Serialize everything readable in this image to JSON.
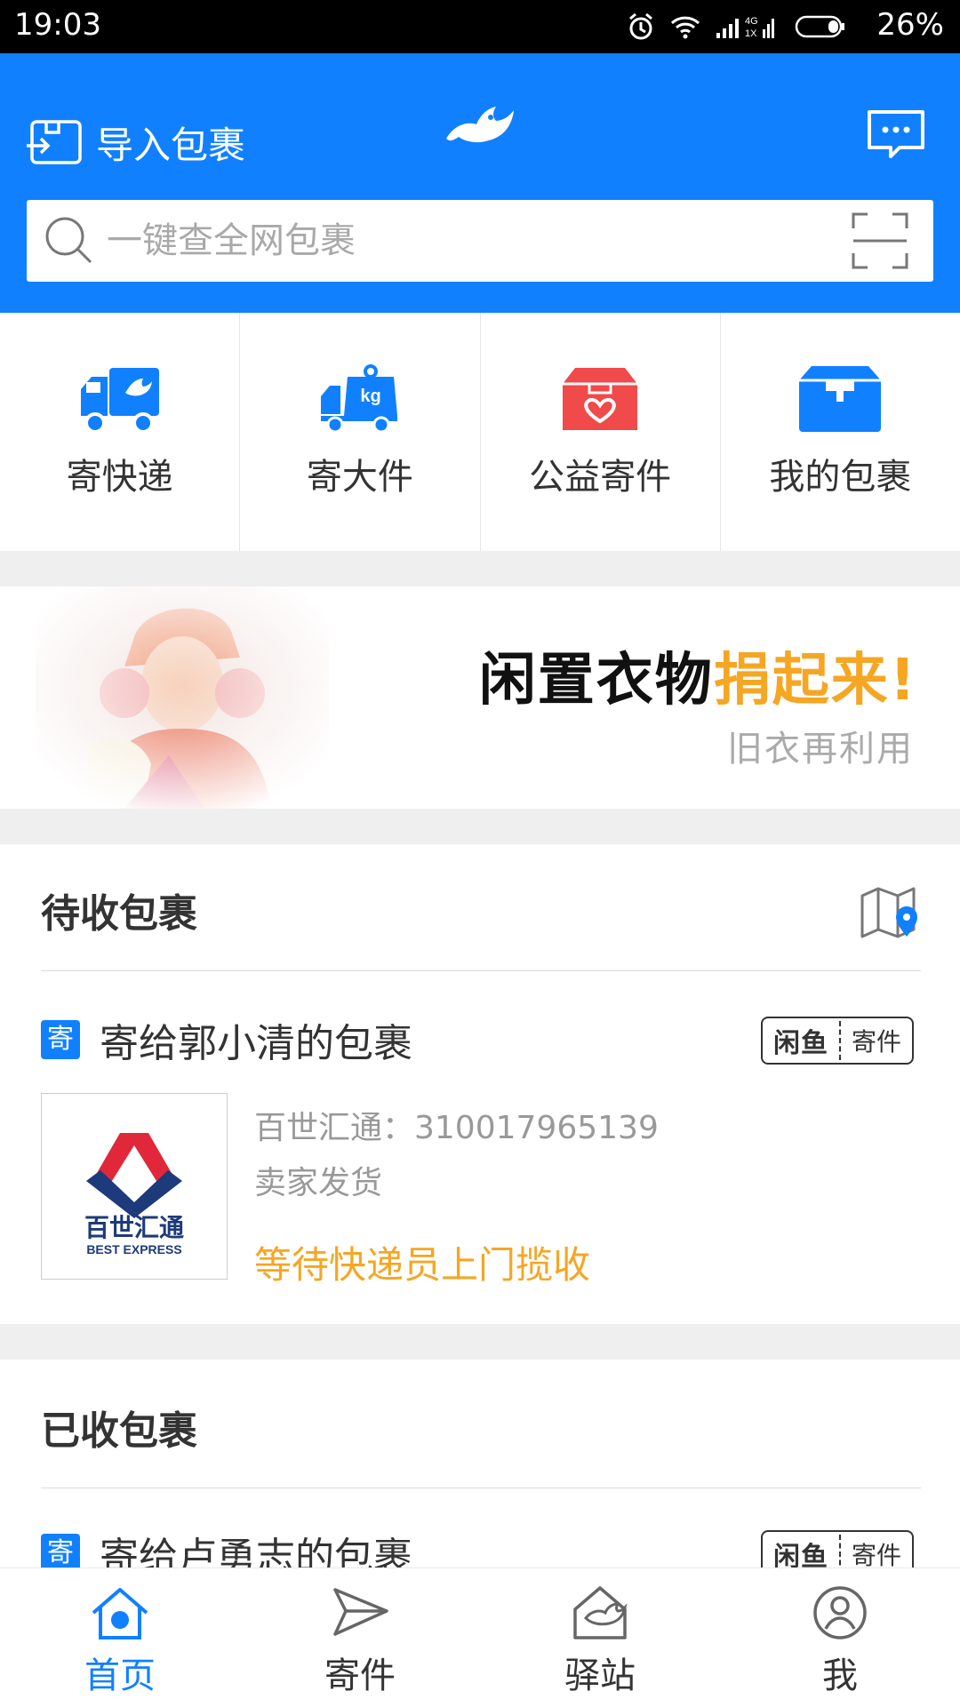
{
  "status_bar": {
    "time": "19:03",
    "network": "4G 1X",
    "battery": "26%",
    "icons": [
      "alarm-icon",
      "wifi-icon",
      "signal-icon",
      "battery-icon"
    ]
  },
  "header": {
    "import_label": "导入包裹",
    "search_placeholder": "一键查全网包裹",
    "accent_color": "#1180ff"
  },
  "quick_actions": [
    {
      "label": "寄快递",
      "icon": "truck-icon",
      "color": "#1180ff"
    },
    {
      "label": "寄大件",
      "icon": "kg-truck-icon",
      "color": "#1180ff"
    },
    {
      "label": "公益寄件",
      "icon": "charity-box-icon",
      "color": "#f04a4a"
    },
    {
      "label": "我的包裹",
      "icon": "package-icon",
      "color": "#1180ff"
    }
  ],
  "banner": {
    "title_dark": "闲置衣物",
    "title_highlight": "捐起来!",
    "subtitle": "旧衣再利用",
    "highlight_color": "#f5a623"
  },
  "pending": {
    "title": "待收包裹",
    "package": {
      "badge": "寄",
      "title": "寄给郭小清的包裹",
      "tag_brand": "闲鱼",
      "tag_label": "寄件",
      "courier_cn": "百世汇通",
      "courier_en": "BEST EXPRESS",
      "tracking": "百世汇通：310017965139",
      "seller_note": "卖家发货",
      "status": "等待快递员上门揽收",
      "status_color": "#f5a623"
    }
  },
  "received": {
    "title": "已收包裹",
    "package": {
      "badge": "寄",
      "title": "寄给卢勇志的包裹",
      "tag_brand": "闲鱼",
      "tag_label": "寄件"
    }
  },
  "bottom_nav": [
    {
      "label": "首页",
      "icon": "home-icon",
      "active": true
    },
    {
      "label": "寄件",
      "icon": "send-plane-icon",
      "active": false
    },
    {
      "label": "驿站",
      "icon": "station-bird-icon",
      "active": false
    },
    {
      "label": "我",
      "icon": "user-icon",
      "active": false
    }
  ]
}
